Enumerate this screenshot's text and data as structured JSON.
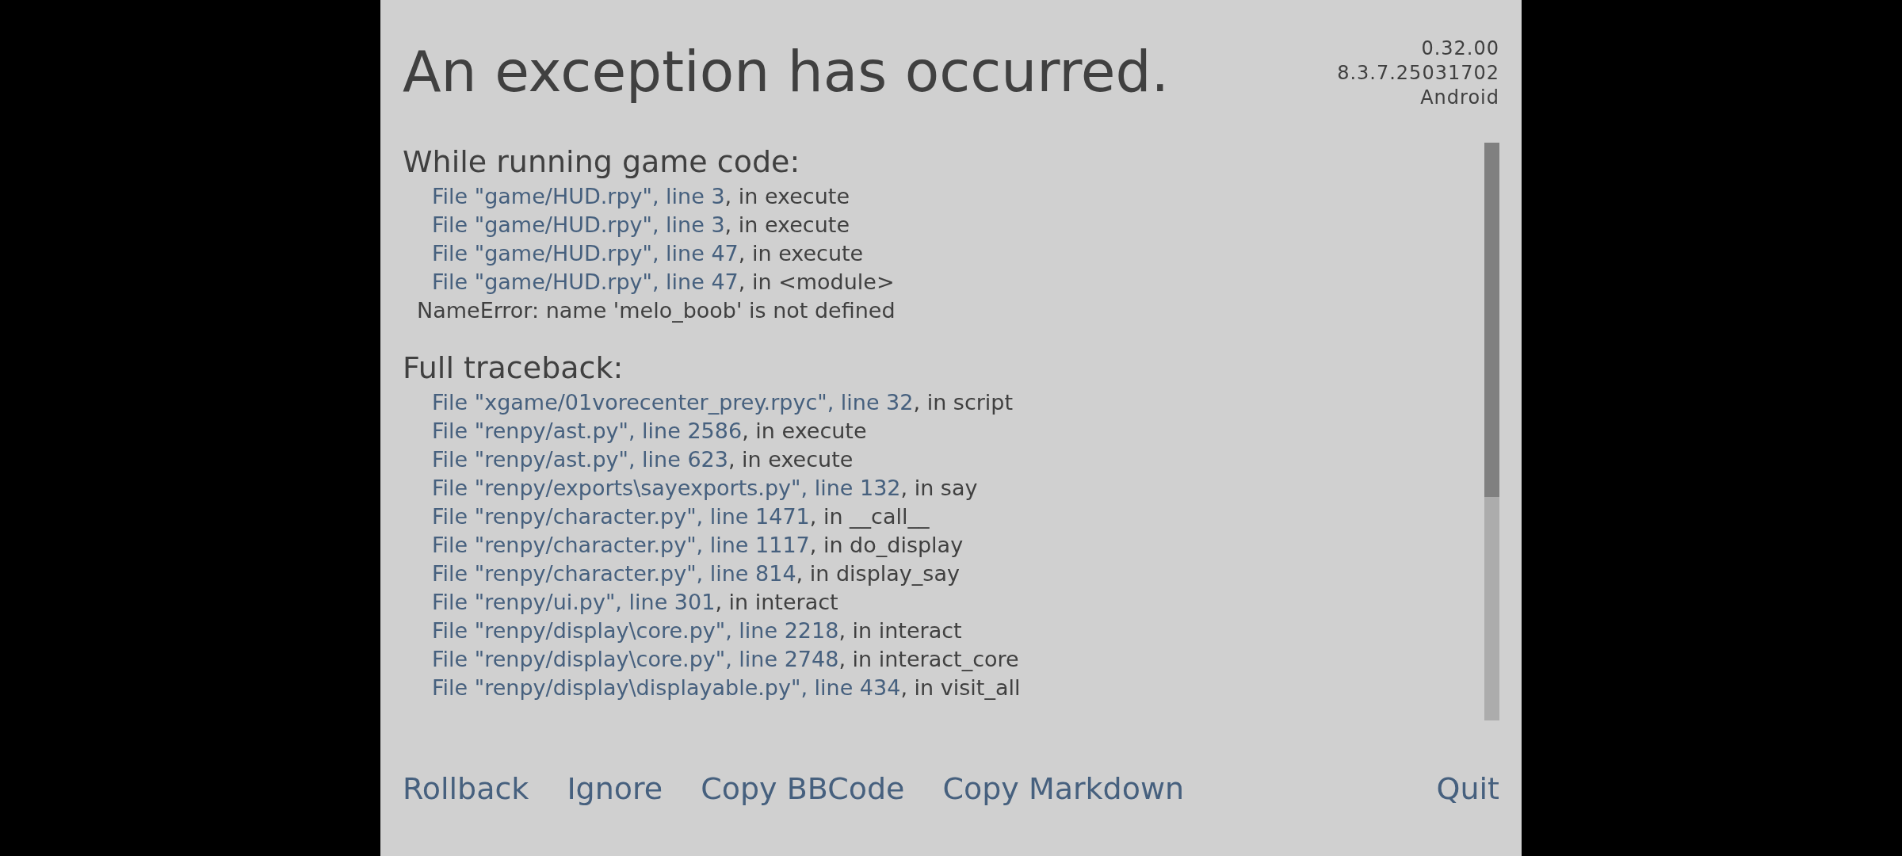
{
  "title": "An exception has occurred.",
  "version_info": [
    "0.32.00",
    "8.3.7.25031702",
    "Android"
  ],
  "sections": [
    {
      "heading": "While running game code:",
      "lines": [
        {
          "kind": "frame",
          "location": "File \"game/HUD.rpy\", line 3",
          "rest": ", in execute"
        },
        {
          "kind": "frame",
          "location": "File \"game/HUD.rpy\", line 3",
          "rest": ", in execute"
        },
        {
          "kind": "frame",
          "location": "File \"game/HUD.rpy\", line 47",
          "rest": ", in execute"
        },
        {
          "kind": "frame",
          "location": "File \"game/HUD.rpy\", line 47",
          "rest": ", in <module>"
        },
        {
          "kind": "error",
          "text": "NameError: name 'melo_boob' is not defined"
        }
      ]
    },
    {
      "heading": "Full traceback:",
      "lines": [
        {
          "kind": "frame",
          "location": "File \"xgame/01vorecenter_prey.rpyc\", line 32",
          "rest": ", in script"
        },
        {
          "kind": "frame",
          "location": "File \"renpy/ast.py\", line 2586",
          "rest": ", in execute"
        },
        {
          "kind": "frame",
          "location": "File \"renpy/ast.py\", line 623",
          "rest": ", in execute"
        },
        {
          "kind": "frame",
          "location": "File \"renpy/exports\\sayexports.py\", line 132",
          "rest": ", in say"
        },
        {
          "kind": "frame",
          "location": "File \"renpy/character.py\", line 1471",
          "rest": ", in __call__"
        },
        {
          "kind": "frame",
          "location": "File \"renpy/character.py\", line 1117",
          "rest": ", in do_display"
        },
        {
          "kind": "frame",
          "location": "File \"renpy/character.py\", line 814",
          "rest": ", in display_say"
        },
        {
          "kind": "frame",
          "location": "File \"renpy/ui.py\", line 301",
          "rest": ", in interact"
        },
        {
          "kind": "frame",
          "location": "File \"renpy/display\\core.py\", line 2218",
          "rest": ", in interact"
        },
        {
          "kind": "frame",
          "location": "File \"renpy/display\\core.py\", line 2748",
          "rest": ", in interact_core"
        },
        {
          "kind": "frame",
          "location": "File \"renpy/display\\displayable.py\", line 434",
          "rest": ", in visit_all"
        }
      ]
    }
  ],
  "buttons": [
    "Rollback",
    "Ignore",
    "Copy BBCode",
    "Copy Markdown"
  ],
  "quit_button": "Quit"
}
